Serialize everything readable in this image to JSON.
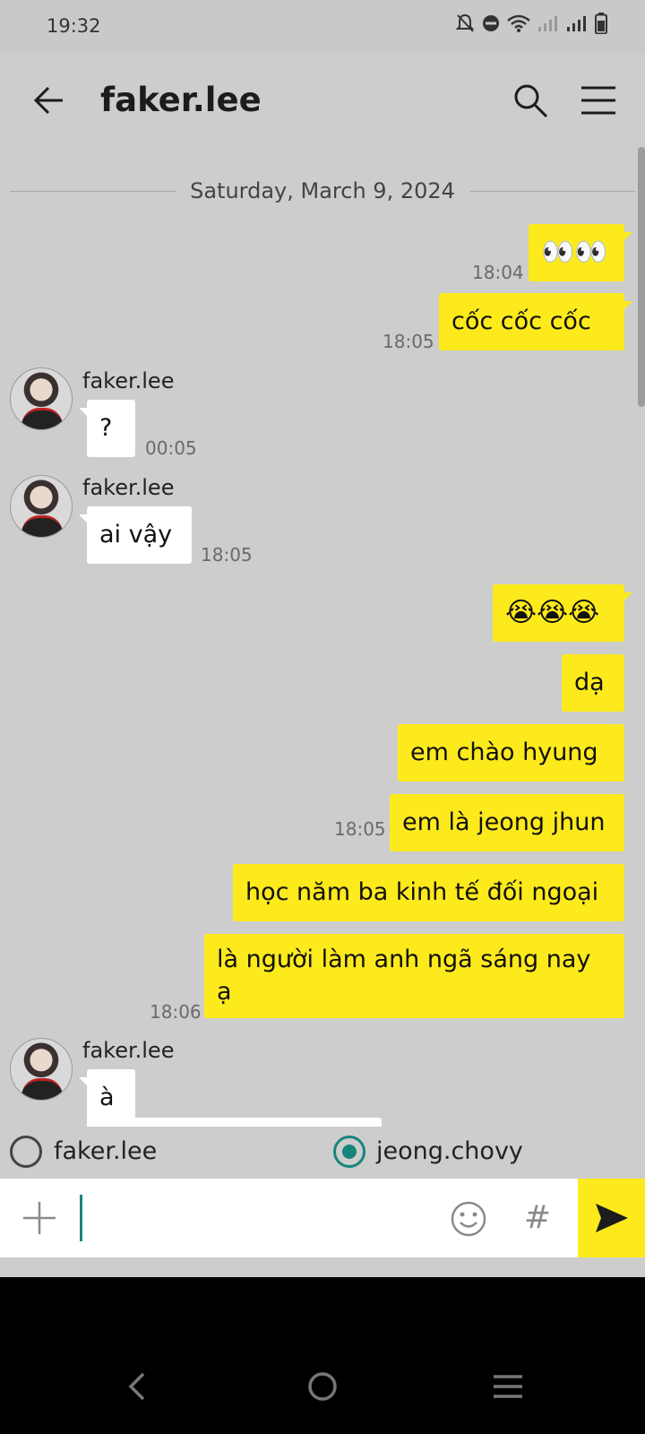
{
  "status_bar": {
    "time": "19:32",
    "icons": [
      "bell-off-icon",
      "dnd-icon",
      "wifi-icon",
      "signal-icon",
      "signal-icon",
      "battery-icon"
    ]
  },
  "header": {
    "title": "faker.lee",
    "back_icon": "back-arrow-icon",
    "search_icon": "search-icon",
    "menu_icon": "menu-icon"
  },
  "date_separator": "Saturday, March 9, 2024",
  "messages": [
    {
      "from": "me",
      "text": "👀👀",
      "time": "18:04"
    },
    {
      "from": "me",
      "text": "cốc cốc cốc",
      "time": "18:05"
    },
    {
      "from": "other",
      "sender": "faker.lee",
      "text": "?",
      "time": "00:05"
    },
    {
      "from": "other",
      "sender": "faker.lee",
      "text": "ai vậy",
      "time": "18:05"
    },
    {
      "from": "me",
      "text": "😭😭😭"
    },
    {
      "from": "me",
      "text": "dạ"
    },
    {
      "from": "me",
      "text": "em chào hyung"
    },
    {
      "from": "me",
      "text": "em là jeong jhun",
      "time": "18:05"
    },
    {
      "from": "me",
      "text": "học năm ba kinh tế đối ngoại"
    },
    {
      "from": "me",
      "text": "là người làm anh ngã sáng nay ạ",
      "time": "18:06"
    },
    {
      "from": "other",
      "sender": "faker.lee",
      "text": "à"
    }
  ],
  "speakers": [
    {
      "label": "faker.lee",
      "selected": false
    },
    {
      "label": "jeong.chovy",
      "selected": true
    }
  ],
  "input": {
    "value": "",
    "plus_icon": "plus-icon",
    "emoji_icon": "emoji-icon",
    "hash_label": "#",
    "send_icon": "send-icon"
  },
  "colors": {
    "my_bubble": "#fdea1c",
    "other_bubble": "#ffffff",
    "chat_background": "#cdcdcd",
    "accent": "#17857a"
  }
}
